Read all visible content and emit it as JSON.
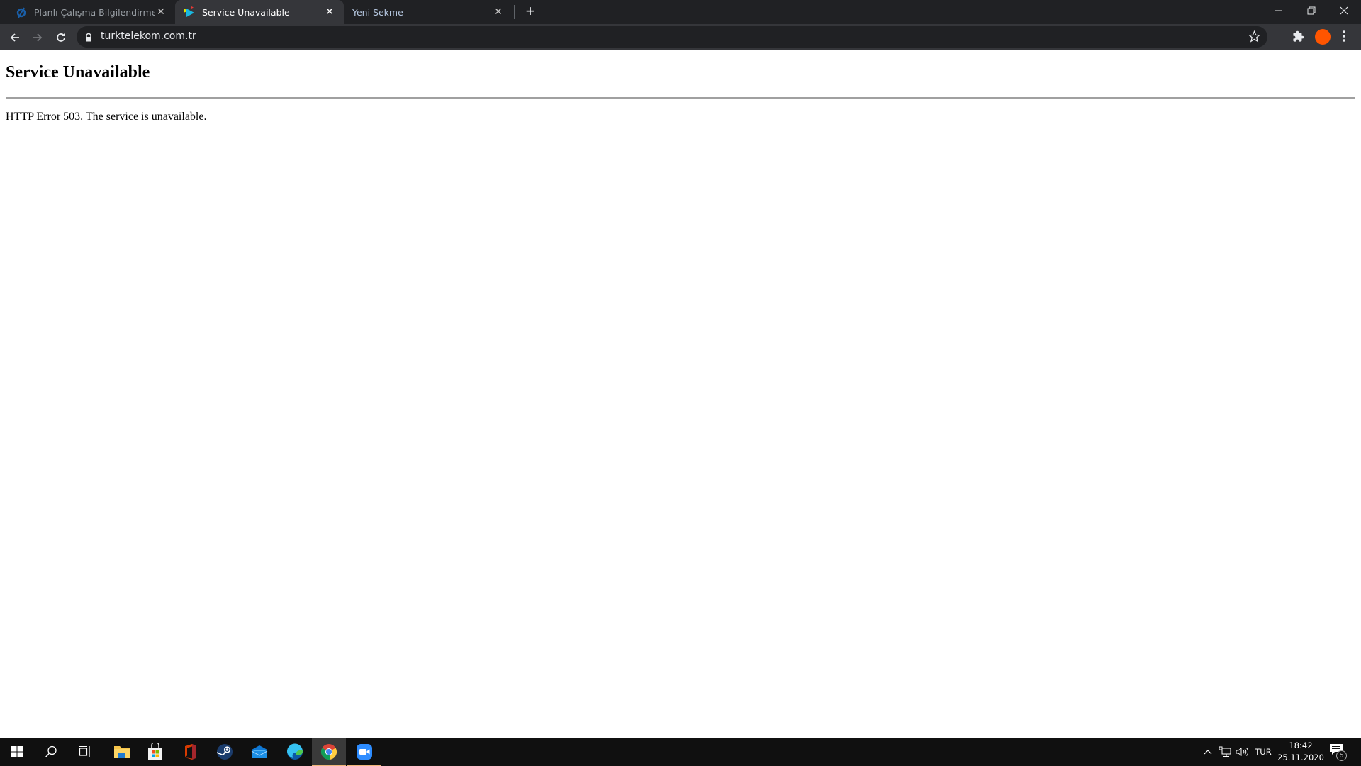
{
  "browser": {
    "tabs": [
      {
        "title": "Planlı Çalışma Bilgilendirme - TURKTELEKOM",
        "favicon": "turktelekom-logo-icon",
        "active": false
      },
      {
        "title": "Service Unavailable",
        "favicon": "play-arrow-favicon-icon",
        "active": true
      },
      {
        "title": "Yeni Sekme",
        "favicon": "",
        "active": false
      }
    ],
    "new_tab_label": "+",
    "address_bar": {
      "url": "turktelekom.com.tr",
      "secure": true
    },
    "profile_color": "#ff5500"
  },
  "page": {
    "heading": "Service Unavailable",
    "message": "HTTP Error 503. The service is unavailable."
  },
  "taskbar": {
    "apps": [
      {
        "name": "start",
        "icon": "windows-start-icon"
      },
      {
        "name": "search",
        "icon": "search-icon"
      },
      {
        "name": "task-view",
        "icon": "task-view-icon"
      },
      {
        "name": "file-explorer",
        "icon": "folder-icon"
      },
      {
        "name": "microsoft-store",
        "icon": "store-bag-icon"
      },
      {
        "name": "office",
        "icon": "office-icon"
      },
      {
        "name": "steam",
        "icon": "steam-icon"
      },
      {
        "name": "mail",
        "icon": "mail-icon"
      },
      {
        "name": "edge",
        "icon": "edge-icon"
      },
      {
        "name": "chrome",
        "icon": "chrome-icon",
        "active": true
      },
      {
        "name": "zoom",
        "icon": "zoom-icon",
        "running": true
      }
    ],
    "tray": {
      "language": "TUR",
      "time": "18:42",
      "date": "25.11.2020",
      "notification_count": "5"
    }
  }
}
